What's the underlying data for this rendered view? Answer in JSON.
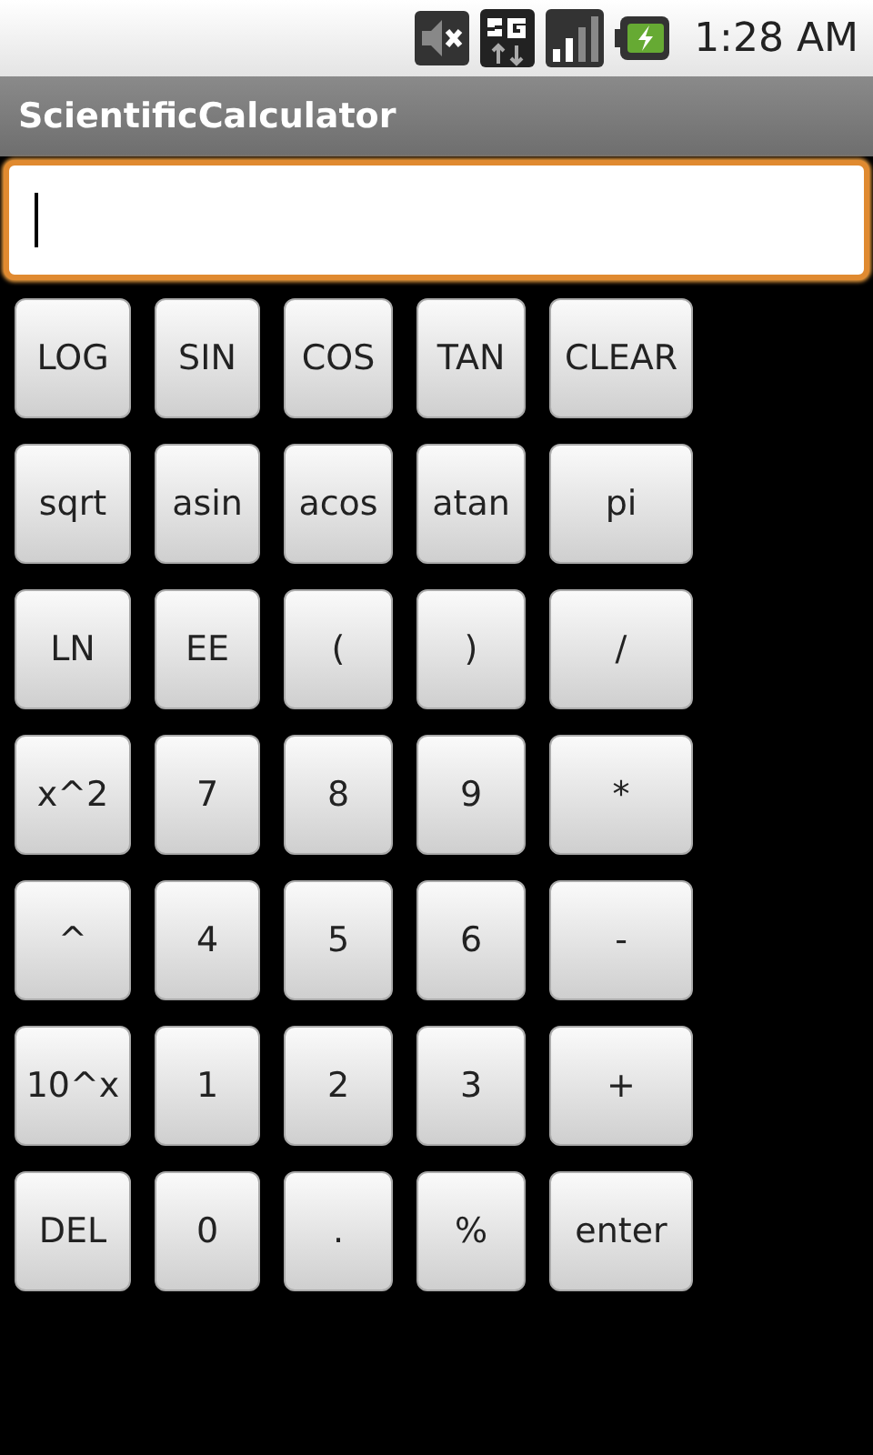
{
  "status_bar": {
    "time": "1:28 AM"
  },
  "window": {
    "title": "ScientificCalculator"
  },
  "display": {
    "focused": true
  },
  "keypad": [
    [
      "LOG",
      "SIN",
      "COS",
      "TAN",
      "CLEAR"
    ],
    [
      "sqrt",
      "asin",
      "acos",
      "atan",
      "pi"
    ],
    [
      "LN",
      "EE",
      "(",
      ")",
      "/"
    ],
    [
      "x^2",
      "7",
      "8",
      "9",
      "*"
    ],
    [
      "^",
      "4",
      "5",
      "6",
      "-"
    ],
    [
      "10^x",
      "1",
      "2",
      "3",
      "+"
    ],
    [
      "DEL",
      "0",
      ".",
      "%",
      "enter"
    ]
  ]
}
